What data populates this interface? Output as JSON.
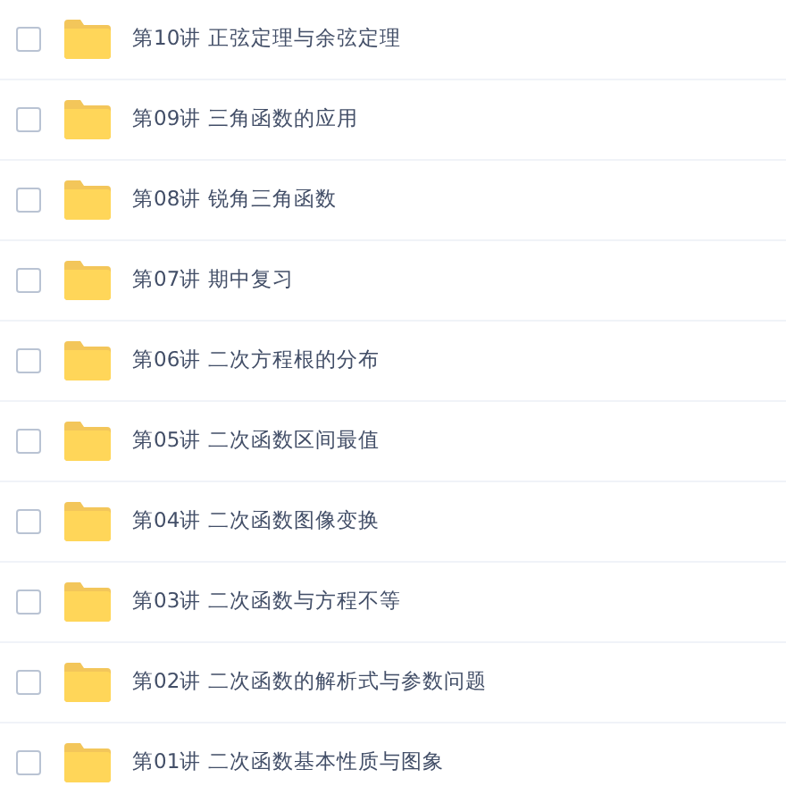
{
  "files": [
    {
      "name": "第10讲 正弦定理与余弦定理",
      "checked": false
    },
    {
      "name": "第09讲 三角函数的应用",
      "checked": false
    },
    {
      "name": "第08讲 锐角三角函数",
      "checked": false
    },
    {
      "name": "第07讲 期中复习",
      "checked": false
    },
    {
      "name": "第06讲 二次方程根的分布",
      "checked": false
    },
    {
      "name": "第05讲 二次函数区间最值",
      "checked": false
    },
    {
      "name": "第04讲 二次函数图像变换",
      "checked": false
    },
    {
      "name": "第03讲 二次函数与方程不等",
      "checked": false
    },
    {
      "name": "第02讲 二次函数的解析式与参数问题",
      "checked": false
    },
    {
      "name": "第01讲 二次函数基本性质与图象",
      "checked": false
    }
  ]
}
